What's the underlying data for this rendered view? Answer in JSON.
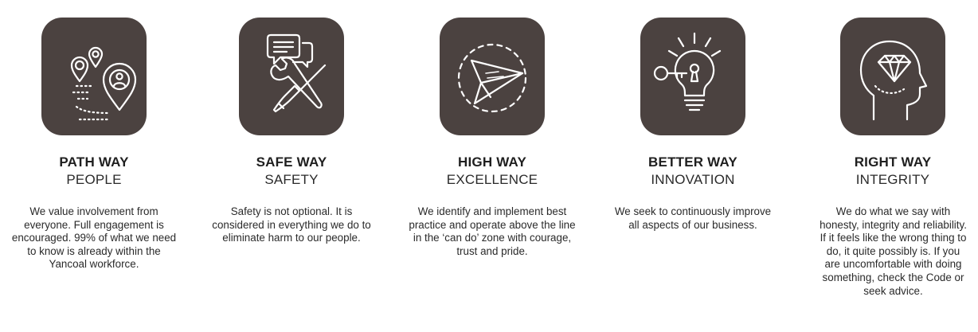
{
  "values": [
    {
      "icon": "map-pins-path-icon",
      "title": "PATH WAY",
      "subtitle": "PEOPLE",
      "description": "We value involvement from everyone. Full engagement is encouraged. 99% of what we need to know is already within the Yancoal workforce."
    },
    {
      "icon": "tools-chat-icon",
      "title": "SAFE WAY",
      "subtitle": "SAFETY",
      "description": "Safety is not optional. It is considered in everything we do to eliminate harm to our people."
    },
    {
      "icon": "paper-plane-icon",
      "title": "HIGH WAY",
      "subtitle": "EXCELLENCE",
      "description": "We identify and implement best practice and operate above the line in the ‘can do’ zone with courage, trust and pride."
    },
    {
      "icon": "lightbulb-key-icon",
      "title": "BETTER WAY",
      "subtitle": "INNOVATION",
      "description": "We seek to continuously improve all aspects of our business."
    },
    {
      "icon": "head-diamond-icon",
      "title": "RIGHT WAY",
      "subtitle": "INTEGRITY",
      "description": "We do what we say with honesty, integrity and reliability. If it feels like the wrong thing to do, it quite possibly is. If you are uncomfortable with doing something, check the Code or seek advice."
    }
  ],
  "colors": {
    "tile": "#4b4240",
    "icon_stroke": "#ffffff",
    "text": "#1f1f1f"
  }
}
